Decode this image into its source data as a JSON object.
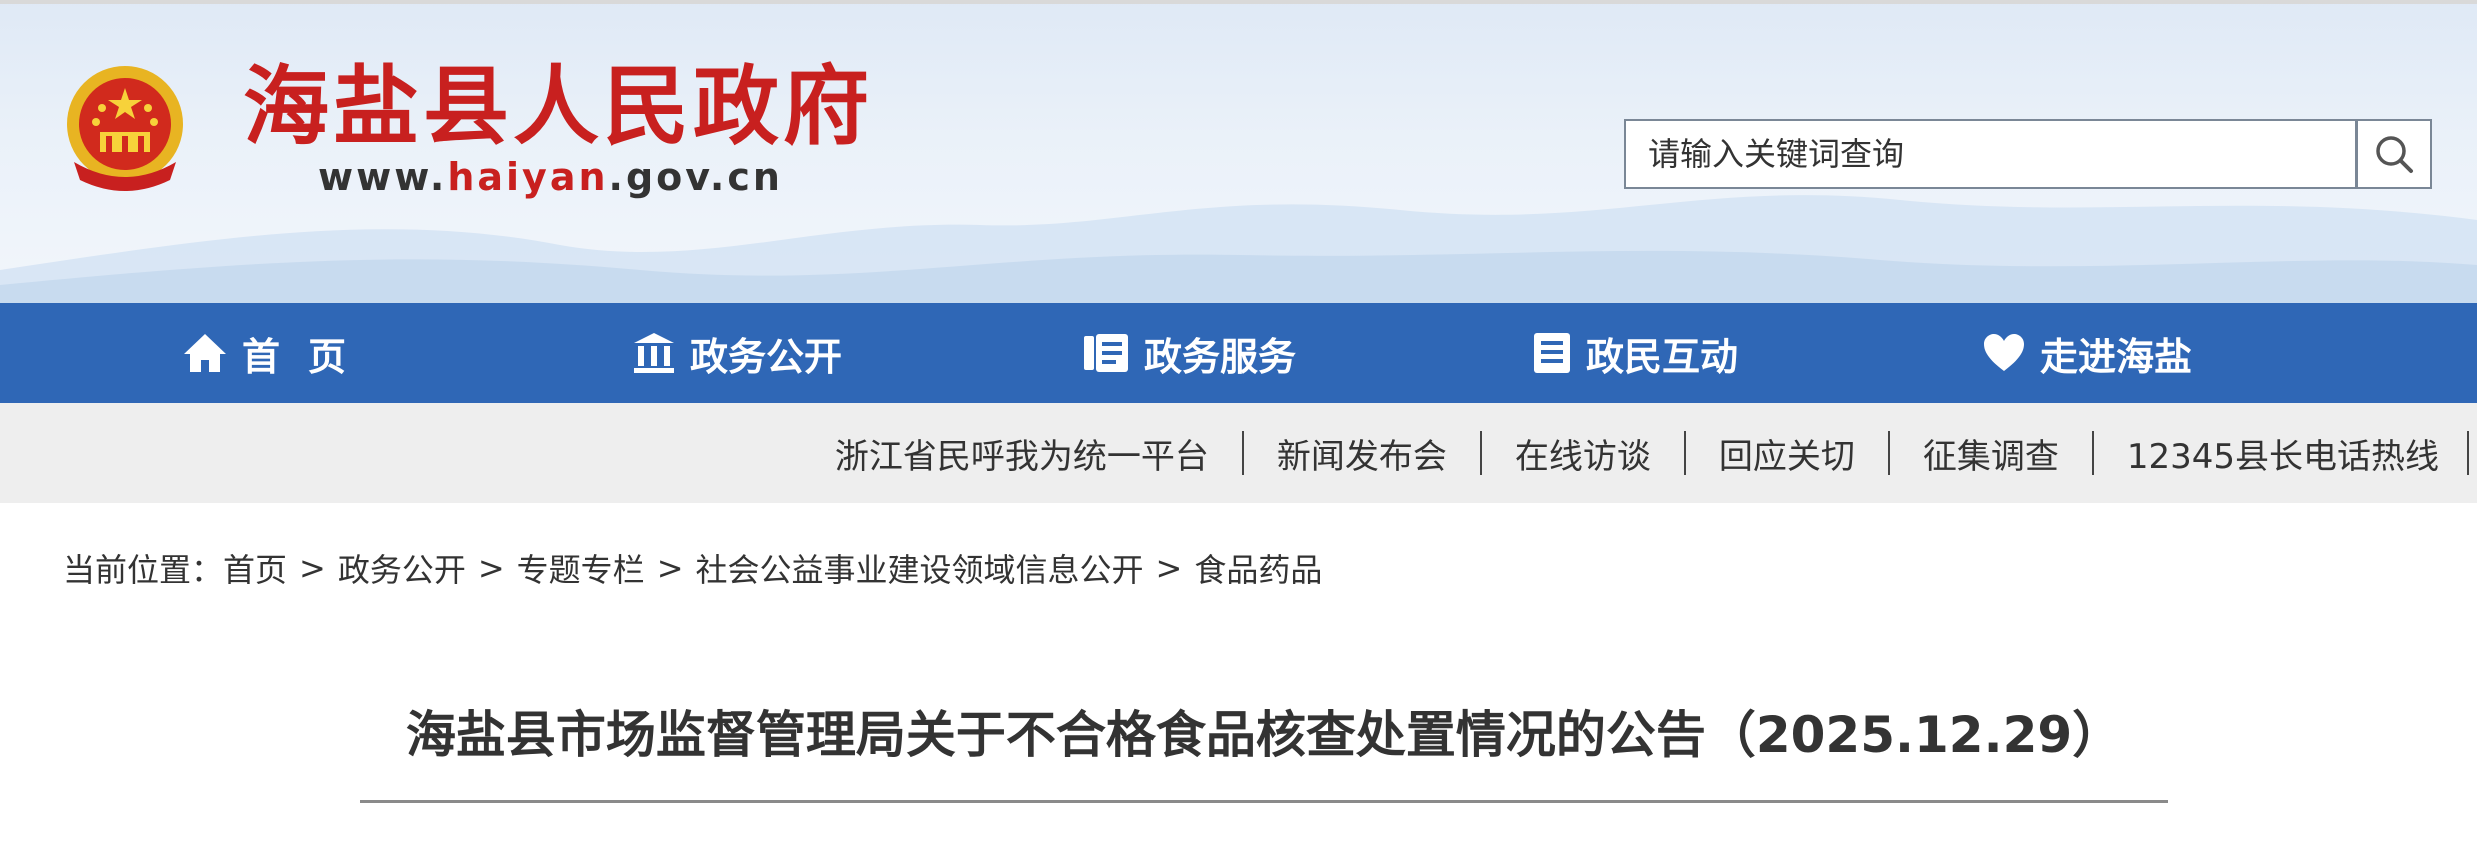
{
  "header": {
    "site_title": "海盐县人民政府",
    "url_prefix": "www.",
    "url_highlight": "haiyan",
    "url_suffix": ".gov.cn",
    "search_placeholder": "请输入关键词查询",
    "search_icon": "search-icon",
    "brand_red": "#c8201f"
  },
  "main_nav": {
    "background": "#2f67b6",
    "items": [
      {
        "label": "首页",
        "icon": "home-icon"
      },
      {
        "label": "政务公开",
        "icon": "government-building-icon"
      },
      {
        "label": "政务服务",
        "icon": "service-list-icon"
      },
      {
        "label": "政民互动",
        "icon": "document-icon"
      },
      {
        "label": "走进海盐",
        "icon": "heart-icon"
      }
    ]
  },
  "sub_nav": {
    "items": [
      {
        "label": "浙江省民呼我为统一平台"
      },
      {
        "label": "新闻发布会"
      },
      {
        "label": "在线访谈"
      },
      {
        "label": "回应关切"
      },
      {
        "label": "征集调查"
      },
      {
        "label": "12345县长电话热线"
      }
    ]
  },
  "breadcrumb": {
    "prefix": "当前位置：",
    "items": [
      "首页",
      "政务公开",
      "专题专栏",
      "社会公益事业建设领域信息公开",
      "食品药品"
    ],
    "separator": ">"
  },
  "article": {
    "title": "海盐县市场监督管理局关于不合格食品核查处置情况的公告（2025.12.29）"
  }
}
